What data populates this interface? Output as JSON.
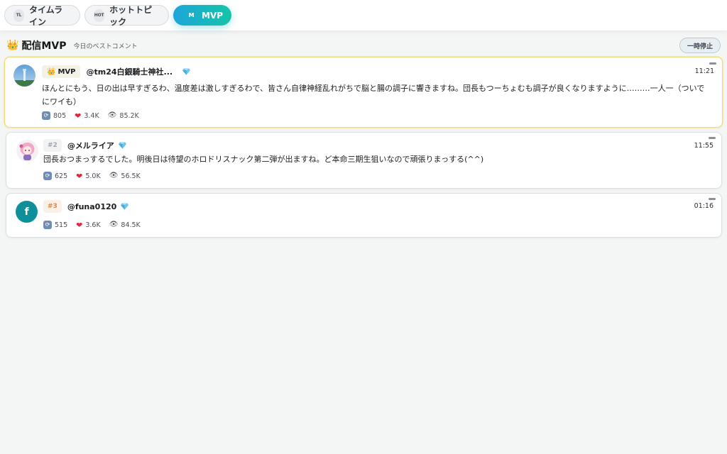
{
  "tabs": [
    {
      "badge": "TL",
      "label": "タイムライン",
      "active": false
    },
    {
      "badge": "HOT",
      "label": "ホットトピック",
      "active": false
    },
    {
      "badge": "M",
      "label": "MVP",
      "active": true
    }
  ],
  "header": {
    "title": "配信MVP",
    "subtitle": "今日のベストコメント",
    "pause_label": "一時停止"
  },
  "comments": [
    {
      "rank": "MVP",
      "user": "@tm24白銀騎士神社...",
      "time": "11:21",
      "text": "ほんとにもう、日の出は早すぎるわ、温度差は激しすぎるわで、皆さん自律神経乱れがちで脳と腸の調子に響きますね。団長もつーちょむも調子が良くなりますように………一人一（ついでにワイも）",
      "retweets": "805",
      "likes": "3.4K",
      "views": "85.2K"
    },
    {
      "rank": "#2",
      "user": "@メルライア",
      "time": "11:55",
      "text": "団長おつまっするでした。明後日は待望のホロドリスナック第二弾が出ますね。ど本命三期生狙いなので頑張りまっする(^^)",
      "retweets": "625",
      "likes": "5.0K",
      "views": "56.5K"
    },
    {
      "rank": "#3",
      "user": "@funa0120",
      "avatar_letter": "f",
      "time": "01:16",
      "text": "",
      "retweets": "515",
      "likes": "3.6K",
      "views": "84.5K"
    }
  ],
  "colors": {
    "accent_start": "#1ea5db",
    "accent_end": "#14c4a8",
    "mvp_border": "#efd97a",
    "avatar_teal": "#0f8f99"
  },
  "icons": {
    "crown": "crown-icon",
    "gem": "gem-icon",
    "retweet": "retweet-icon",
    "like": "heart-icon",
    "views": "eye-icon",
    "menu": "menu-dash-icon"
  }
}
